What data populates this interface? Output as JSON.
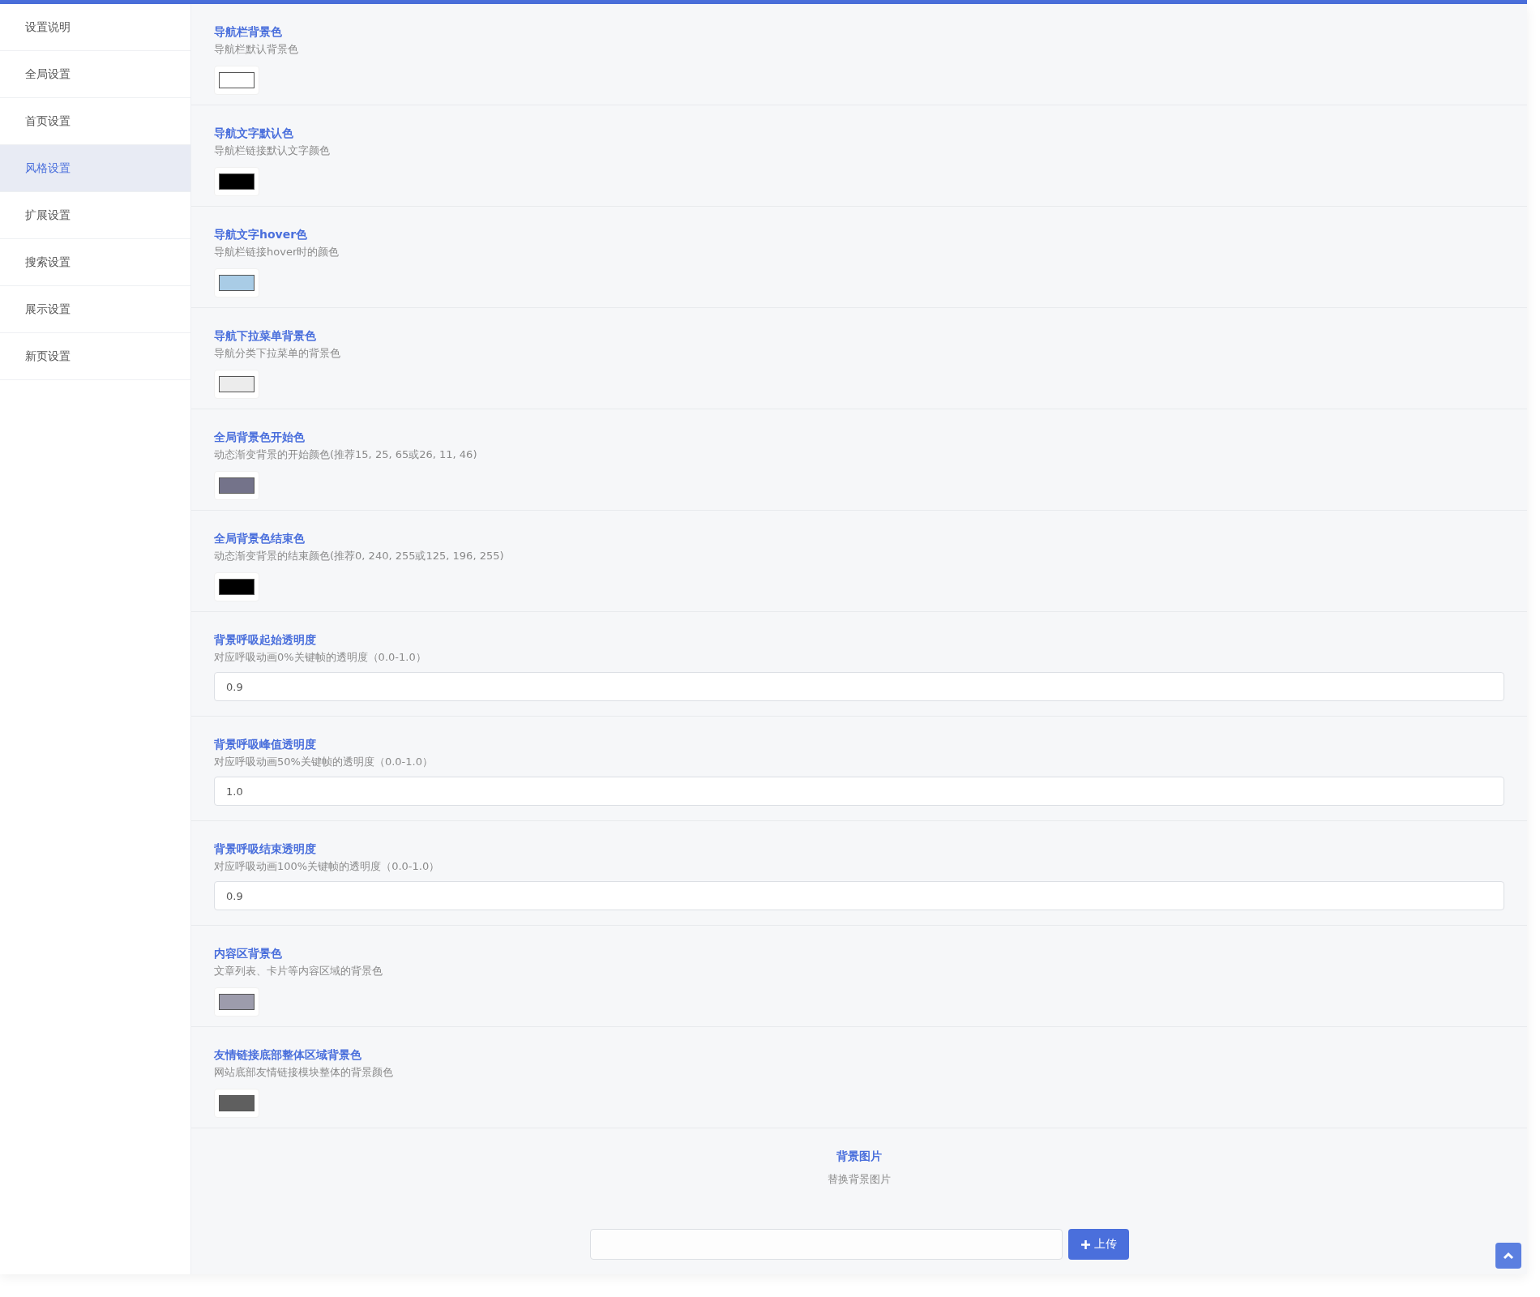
{
  "sidebar": {
    "items": [
      {
        "label": "设置说明",
        "selected": false
      },
      {
        "label": "全局设置",
        "selected": false
      },
      {
        "label": "首页设置",
        "selected": false
      },
      {
        "label": "风格设置",
        "selected": true
      },
      {
        "label": "扩展设置",
        "selected": false
      },
      {
        "label": "搜索设置",
        "selected": false
      },
      {
        "label": "展示设置",
        "selected": false
      },
      {
        "label": "新页设置",
        "selected": false
      }
    ]
  },
  "settings": [
    {
      "kind": "color",
      "title": "导航栏背景色",
      "description": "导航栏默认背景色",
      "color": "#ffffff"
    },
    {
      "kind": "color",
      "title": "导航文字默认色",
      "description": "导航栏链接默认文字颜色",
      "color": "#000000"
    },
    {
      "kind": "color",
      "title": "导航文字hover色",
      "description": "导航栏链接hover时的颜色",
      "color": "#a9cce6"
    },
    {
      "kind": "color",
      "title": "导航下拉菜单背景色",
      "description": "导航分类下拉菜单的背景色",
      "color": "#ececec"
    },
    {
      "kind": "color",
      "title": "全局背景色开始色",
      "description": "动态渐变背景的开始颜色(推荐15, 25, 65或26, 11, 46)",
      "color": "#74738a"
    },
    {
      "kind": "color",
      "title": "全局背景色结束色",
      "description": "动态渐变背景的结束颜色(推荐0, 240, 255或125, 196, 255)",
      "color": "#000000"
    },
    {
      "kind": "text",
      "title": "背景呼吸起始透明度",
      "description": "对应呼吸动画0%关键帧的透明度（0.0-1.0）",
      "value": "0.9"
    },
    {
      "kind": "text",
      "title": "背景呼吸峰值透明度",
      "description": "对应呼吸动画50%关键帧的透明度（0.0-1.0）",
      "value": "1.0"
    },
    {
      "kind": "text",
      "title": "背景呼吸结束透明度",
      "description": "对应呼吸动画100%关键帧的透明度（0.0-1.0）",
      "value": "0.9"
    },
    {
      "kind": "color",
      "title": "内容区背景色",
      "description": "文章列表、卡片等内容区域的背景色",
      "color": "#9d9cac"
    },
    {
      "kind": "color",
      "title": "友情链接底部整体区域背景色",
      "description": "网站底部友情链接模块整体的背景颜色",
      "color": "#5f5f5f"
    },
    {
      "kind": "upload",
      "title": "背景图片",
      "description": "替换背景图片",
      "button": "上传"
    }
  ]
}
